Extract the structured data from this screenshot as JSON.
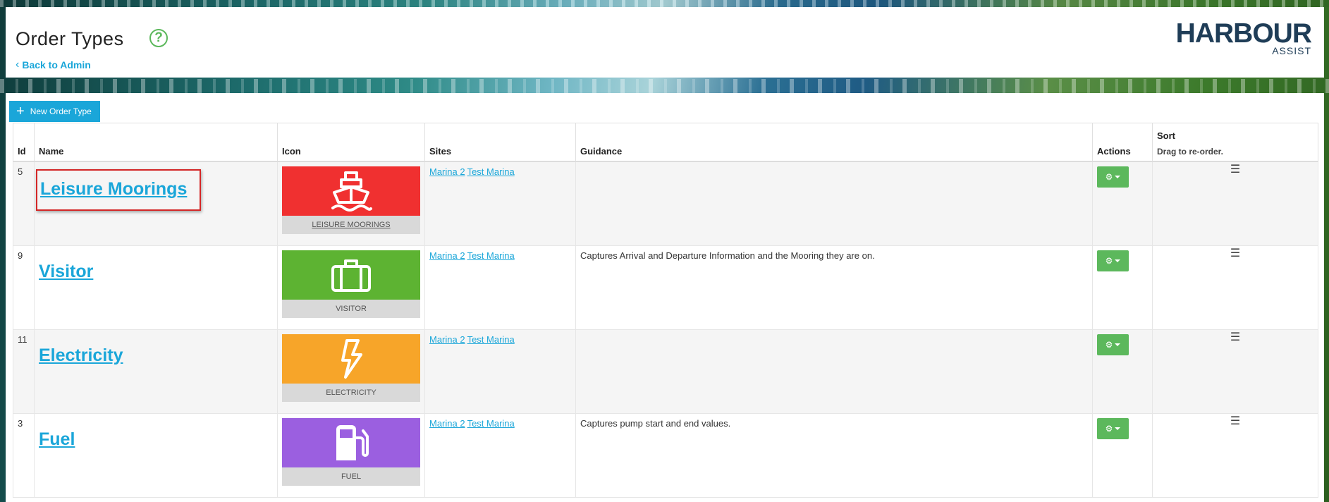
{
  "header": {
    "title": "Order Types",
    "back_label": "Back to Admin",
    "logo_main": "HARBOUR",
    "logo_sub": "ASSIST"
  },
  "toolbar": {
    "new_label": "New Order Type"
  },
  "table": {
    "columns": {
      "id": "Id",
      "name": "Name",
      "icon": "Icon",
      "sites": "Sites",
      "guidance": "Guidance",
      "actions": "Actions",
      "sort": "Sort",
      "sort_sub": "Drag to re-order."
    },
    "rows": [
      {
        "id": "5",
        "name": "Leisure Moorings",
        "icon_label": "LEISURE MOORINGS",
        "icon_name": "ship-icon",
        "color": "#f03030",
        "sites": [
          "Marina 2",
          "Test Marina"
        ],
        "guidance": "",
        "highlighted": true
      },
      {
        "id": "9",
        "name": "Visitor",
        "icon_label": "VISITOR",
        "icon_name": "briefcase-icon",
        "color": "#5db332",
        "sites": [
          "Marina 2",
          "Test Marina"
        ],
        "guidance": "Captures Arrival and Departure Information and the Mooring they are on."
      },
      {
        "id": "11",
        "name": "Electricity",
        "icon_label": "ELECTRICITY",
        "icon_name": "lightning-icon",
        "color": "#f7a529",
        "sites": [
          "Marina 2",
          "Test Marina"
        ],
        "guidance": ""
      },
      {
        "id": "3",
        "name": "Fuel",
        "icon_label": "FUEL",
        "icon_name": "fuel-pump-icon",
        "color": "#9b5fe0",
        "sites": [
          "Marina 2",
          "Test Marina"
        ],
        "guidance": "Captures pump start and end values."
      }
    ]
  },
  "colors": {
    "accent": "#1aa6d9",
    "action_green": "#5cb85c",
    "highlight_red": "#d32626"
  }
}
